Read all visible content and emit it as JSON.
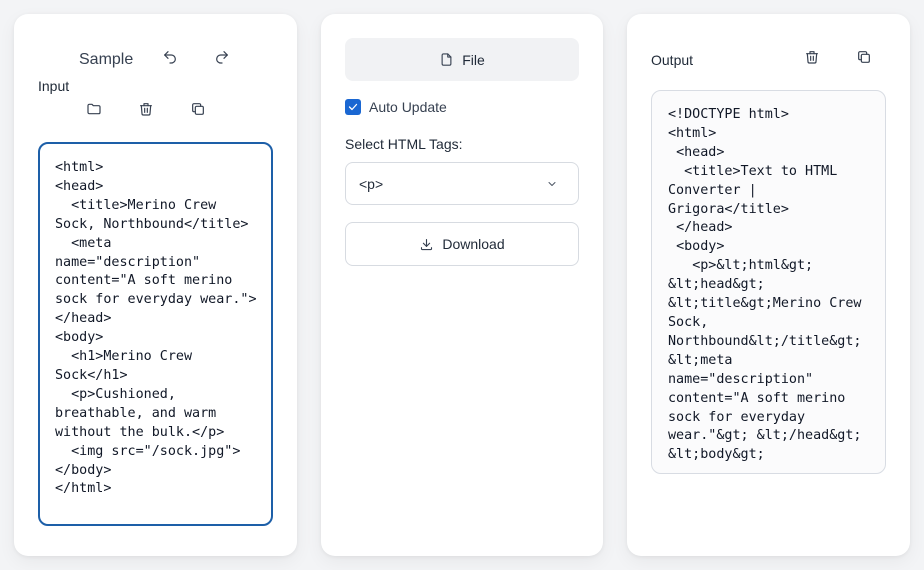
{
  "input_panel": {
    "sample_label": "Sample",
    "input_label": "Input",
    "icons": [
      "undo-icon",
      "redo-icon",
      "folder-icon",
      "trash-icon",
      "copy-icon"
    ],
    "editor_value": "<html>\n<head>\n  <title>Merino Crew Sock, Northbound</title>\n  <meta name=\"description\" content=\"A soft merino sock for everyday wear.\">\n</head>\n<body>\n  <h1>Merino Crew Sock</h1>\n  <p>Cushioned, breathable, and warm without the bulk.</p>\n  <img src=\"/sock.jpg\">\n</body>\n</html>"
  },
  "controls_panel": {
    "file_label": "File",
    "auto_update_label": "Auto Update",
    "auto_update_checked": true,
    "select_tags_label": "Select HTML Tags:",
    "selected_tag": "<p>",
    "download_label": "Download"
  },
  "output_panel": {
    "output_label": "Output",
    "icons": [
      "trash-icon",
      "copy-icon"
    ],
    "output_value": "<!DOCTYPE html>\n<html>\n <head>\n  <title>Text to HTML Converter | Grigora</title>\n </head>\n <body>\n   <p>&lt;html&gt; &lt;head&gt; &lt;title&gt;Merino Crew Sock, Northbound&lt;/title&gt;   &lt;meta name=\"description\" content=\"A soft merino sock for everyday wear.\"&gt; &lt;/head&gt; &lt;body&gt;"
  },
  "colors": {
    "accent": "#1a67d2",
    "editor_border": "#1d5fa8",
    "background": "#f3f4f6"
  }
}
